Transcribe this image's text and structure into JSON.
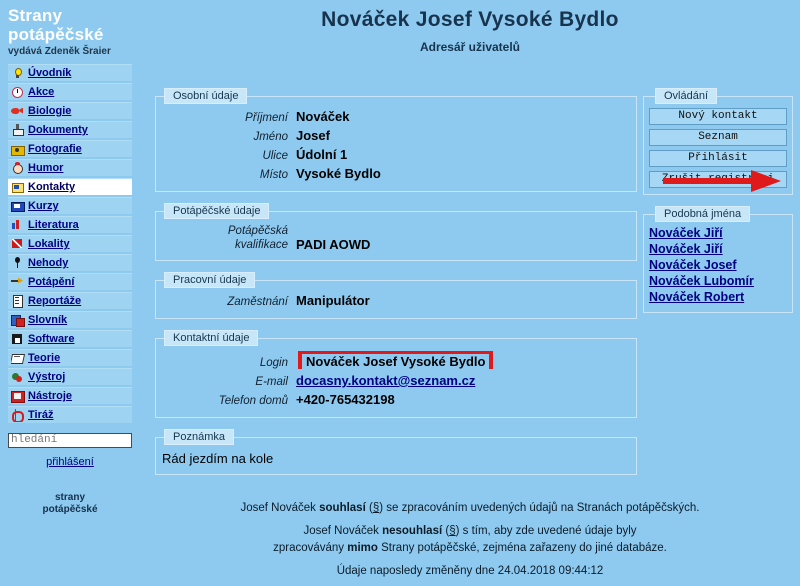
{
  "site": {
    "brand_line1": "Strany",
    "brand_line2": "potápěčské",
    "publisher": "vydává Zdeněk Šraier",
    "footer_line1": "strany",
    "footer_line2": "potápěčské",
    "login_link": "přihlášení"
  },
  "search": {
    "value": "hledání",
    "placeholder": "hledání"
  },
  "menu": [
    {
      "label": "Úvodník",
      "icon": "lightbulb-icon",
      "ic": "ic-bulb",
      "active": false
    },
    {
      "label": "Akce",
      "icon": "clock-icon",
      "ic": "ic-clock",
      "active": false
    },
    {
      "label": "Biologie",
      "icon": "fish-icon",
      "ic": "ic-fish",
      "active": false
    },
    {
      "label": "Dokumenty",
      "icon": "stamp-icon",
      "ic": "ic-stamp",
      "active": false
    },
    {
      "label": "Fotografie",
      "icon": "camera-icon",
      "ic": "ic-cam",
      "active": false
    },
    {
      "label": "Humor",
      "icon": "clown-icon",
      "ic": "ic-clown",
      "active": false
    },
    {
      "label": "Kontakty",
      "icon": "contact-card-icon",
      "ic": "ic-card",
      "active": true
    },
    {
      "label": "Kurzy",
      "icon": "certificate-icon",
      "ic": "ic-kurz",
      "active": false
    },
    {
      "label": "Literatura",
      "icon": "books-icon",
      "ic": "ic-bars",
      "active": false
    },
    {
      "label": "Lokality",
      "icon": "diver-flag-icon",
      "ic": "ic-flag",
      "active": false
    },
    {
      "label": "Nehody",
      "icon": "pin-icon",
      "ic": "ic-pin",
      "active": false
    },
    {
      "label": "Potápění",
      "icon": "arrow-icon",
      "ic": "ic-arrowd",
      "active": false
    },
    {
      "label": "Reportáže",
      "icon": "document-icon",
      "ic": "ic-doc",
      "active": false
    },
    {
      "label": "Slovník",
      "icon": "dictionary-icon",
      "ic": "ic-slov",
      "active": false
    },
    {
      "label": "Software",
      "icon": "floppy-disk-icon",
      "ic": "ic-disk",
      "active": false
    },
    {
      "label": "Teorie",
      "icon": "book-icon",
      "ic": "ic-book",
      "active": false
    },
    {
      "label": "Výstroj",
      "icon": "gear-icon",
      "ic": "ic-gear",
      "active": false
    },
    {
      "label": "Nástroje",
      "icon": "toolbox-icon",
      "ic": "ic-tool",
      "active": false
    },
    {
      "label": "Tiráž",
      "icon": "dollar-icon",
      "ic": "ic-dollar",
      "active": false
    }
  ],
  "page": {
    "title": "Nováček Josef Vysoké Bydlo",
    "subtitle": "Adresář uživatelů"
  },
  "personal": {
    "legend": "Osobní údaje",
    "fields": [
      {
        "label": "Příjmení",
        "value": "Nováček"
      },
      {
        "label": "Jméno",
        "value": "Josef"
      },
      {
        "label": "Ulice",
        "value": "Údolní 1"
      },
      {
        "label": "Místo",
        "value": "Vysoké Bydlo"
      }
    ]
  },
  "diving": {
    "legend": "Potápěčské údaje",
    "label_line1": "Potápěčská",
    "label_line2": "kvalifikace",
    "value": "PADI AOWD"
  },
  "work": {
    "legend": "Pracovní údaje",
    "label": "Zaměstnání",
    "value": "Manipulátor"
  },
  "contact": {
    "legend": "Kontaktní údaje",
    "login_label": "Login",
    "login_value": "Nováček Josef Vysoké Bydlo",
    "email_label": "E-mail",
    "email_value": "docasny.kontakt@seznam.cz",
    "phone_label": "Telefon domů",
    "phone_value": "+420-765432198"
  },
  "note": {
    "legend": "Poznámka",
    "text": "Rád jezdím na kole"
  },
  "controls": {
    "legend": "Ovládání",
    "buttons": [
      {
        "label": "Nový kontakt"
      },
      {
        "label": "Seznam"
      },
      {
        "label": "Přihlásit"
      },
      {
        "label": "Zrušit registraci"
      }
    ]
  },
  "similar": {
    "legend": "Podobná jména",
    "names": [
      "Nováček Jiří",
      "Nováček Jiří",
      "Nováček Josef",
      "Nováček Lubomír",
      "Nováček Robert"
    ]
  },
  "legal": {
    "p1_a": "Josef Nováček ",
    "p1_b": "souhlasí",
    "p1_c": " (",
    "p1_sym": "§",
    "p1_d": ") se zpracováním uvedených údajů na Stranách potápěčských.",
    "p2_a": "Josef Nováček ",
    "p2_b": "nesouhlasí",
    "p2_c": " (",
    "p2_sym": "§",
    "p2_d": ") s tím, aby zde uvedené údaje byly",
    "p3_a": "zpracovávány ",
    "p3_b": "mimo",
    "p3_c": " Strany potápěčské, zejména zařazeny do jiné databáze.",
    "last": "Údaje naposledy změněny dne 24.04.2018 09:44:12"
  },
  "colors": {
    "page_background": "#8ecaf0",
    "accent_red": "#e01a1a",
    "link_blue": "#000080",
    "legend_background": "#c7e6f8",
    "button_background": "#a6d7f4"
  },
  "annotation": {
    "arrow": "red-arrow-pointing-to-prihlasit-button",
    "login_highlight": "red-box-around-login-value"
  }
}
